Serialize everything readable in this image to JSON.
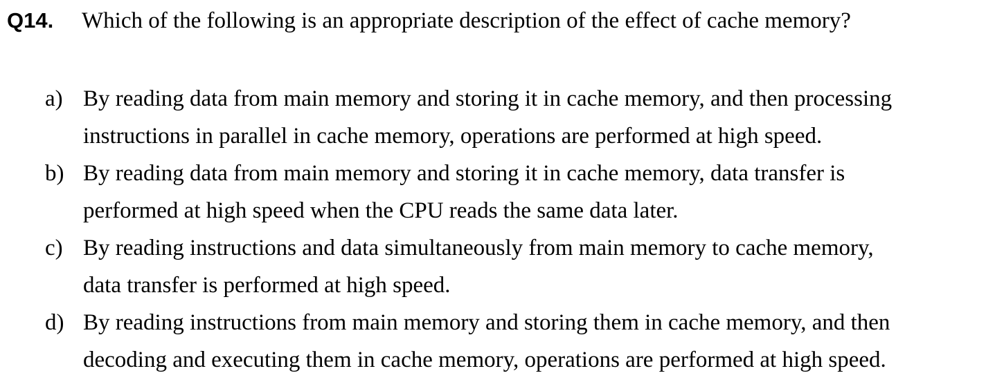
{
  "question": {
    "number": "Q14.",
    "text": "Which of the following is an appropriate description of the effect of cache memory?"
  },
  "options": [
    {
      "letter": "a)",
      "lines": [
        "By reading data from main memory and storing it in cache memory, and then processing",
        "instructions in parallel in cache memory, operations are performed at high speed."
      ]
    },
    {
      "letter": "b)",
      "lines": [
        "By reading data from main memory and storing it in cache memory, data transfer is",
        "performed at high speed when the CPU reads the same data later."
      ]
    },
    {
      "letter": "c)",
      "lines": [
        "By reading instructions and data simultaneously from main memory to cache memory,",
        "data transfer is performed at high speed."
      ]
    },
    {
      "letter": "d)",
      "lines": [
        "By reading instructions from main memory and storing them in cache memory, and then",
        "decoding and executing them in cache memory, operations are performed at high speed."
      ]
    }
  ]
}
